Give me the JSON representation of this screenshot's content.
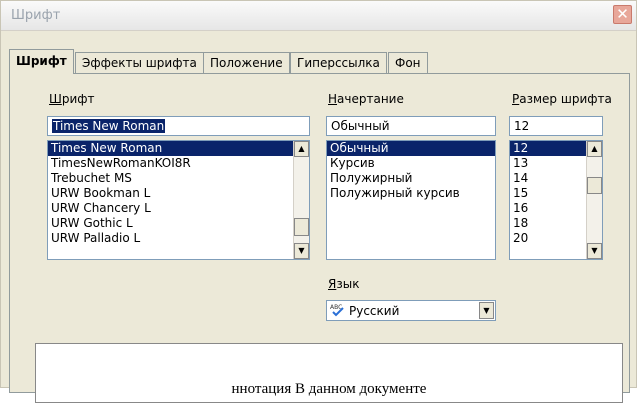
{
  "window": {
    "title": "Шрифт",
    "close_glyph": "✕"
  },
  "tabs": [
    {
      "label": "Шрифт",
      "active": true
    },
    {
      "label": "Эффекты шрифта"
    },
    {
      "label": "Положение"
    },
    {
      "label": "Гиперссылка"
    },
    {
      "label": "Фон"
    }
  ],
  "font_family": {
    "label_accel": "Ш",
    "label_rest": "рифт",
    "value": "Times New Roman",
    "items": [
      "Times New Roman",
      "TimesNewRomanKOI8R",
      "Trebuchet MS",
      "URW Bookman L",
      "URW Chancery L",
      "URW Gothic L",
      "URW Palladio L"
    ],
    "selected_index": 0
  },
  "typeface": {
    "label_accel": "Н",
    "label_rest": "ачертание",
    "value": "Обычный",
    "items": [
      "Обычный",
      "Курсив",
      "Полужирный",
      "Полужирный курсив"
    ],
    "selected_index": 0
  },
  "size": {
    "label_accel": "Р",
    "label_rest": "азмер шрифта",
    "value": "12",
    "items": [
      "12",
      "13",
      "14",
      "15",
      "16",
      "18",
      "20"
    ],
    "selected_index": 0
  },
  "language": {
    "label_accel": "Я",
    "label_rest": "зык",
    "value": "Русский",
    "icon": "spellcheck-abc-icon"
  },
  "preview": {
    "text": "ннотация В данном документе"
  },
  "colors": {
    "selection": "#0a246a",
    "panel_bg": "#ece9d8",
    "border": "#7f9db9"
  }
}
